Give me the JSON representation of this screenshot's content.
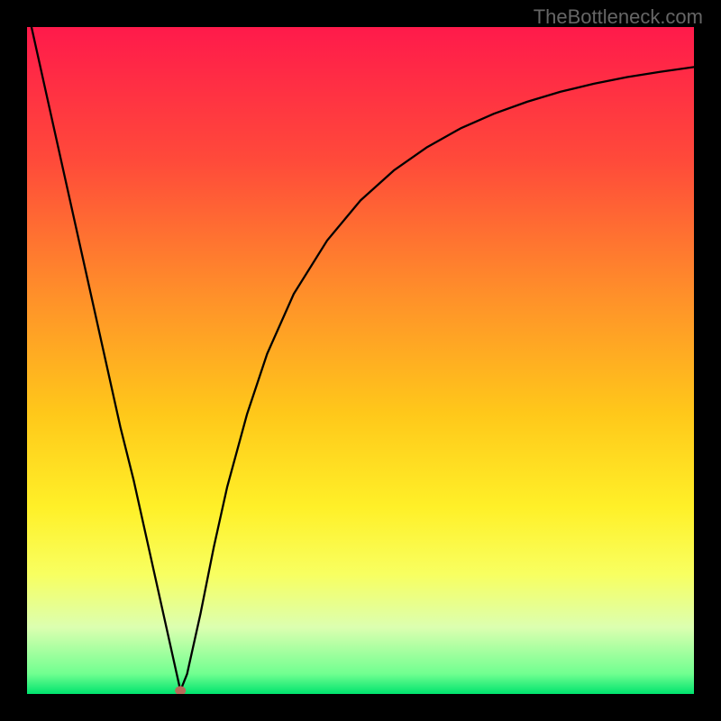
{
  "watermark": "TheBottleneck.com",
  "chart_data": {
    "type": "line",
    "title": "",
    "xlabel": "",
    "ylabel": "",
    "xlim": [
      0,
      100
    ],
    "ylim": [
      0,
      100
    ],
    "gradient_stops": [
      {
        "offset": 0,
        "color": "#ff1a4b"
      },
      {
        "offset": 20,
        "color": "#ff4a3a"
      },
      {
        "offset": 40,
        "color": "#ff8f2a"
      },
      {
        "offset": 58,
        "color": "#ffc81a"
      },
      {
        "offset": 72,
        "color": "#fff028"
      },
      {
        "offset": 82,
        "color": "#f8ff60"
      },
      {
        "offset": 90,
        "color": "#dcffb0"
      },
      {
        "offset": 97,
        "color": "#70ff90"
      },
      {
        "offset": 100,
        "color": "#00e36e"
      }
    ],
    "series": [
      {
        "name": "bottleneck-curve",
        "x": [
          0,
          2,
          4,
          6,
          8,
          10,
          12,
          14,
          16,
          18,
          20,
          22,
          23,
          24,
          26,
          28,
          30,
          33,
          36,
          40,
          45,
          50,
          55,
          60,
          65,
          70,
          75,
          80,
          85,
          90,
          95,
          100
        ],
        "y": [
          103,
          94,
          85,
          76,
          67,
          58,
          49,
          40,
          32,
          23,
          14,
          5,
          0.5,
          3,
          12,
          22,
          31,
          42,
          51,
          60,
          68,
          74,
          78.5,
          82,
          84.8,
          87,
          88.8,
          90.3,
          91.5,
          92.5,
          93.3,
          94
        ]
      }
    ],
    "marker": {
      "x": 23,
      "y": 0.5,
      "color": "#b86a5a"
    }
  }
}
